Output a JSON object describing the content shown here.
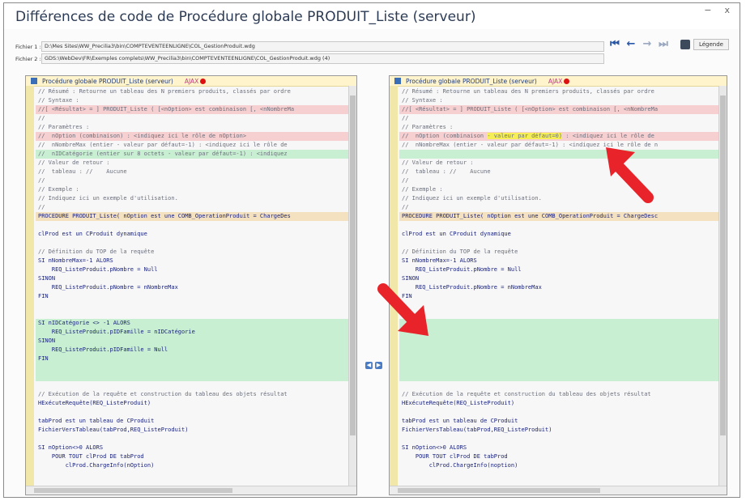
{
  "window": {
    "title": "Différences de code de Procédure globale PRODUIT_Liste (serveur)",
    "min": "−",
    "close": "x"
  },
  "files": {
    "label1": "Fichier 1 :",
    "path1": "D:\\Mes Sites\\WW_Precilia3\\bin\\COMPTEVENTEENLIGNE\\COL_GestionProduit.wdg",
    "label2": "Fichier 2 :",
    "path2": "GDS:\\WebDev\\FR\\Exemples complets\\WW_Precilia3\\bin\\COMPTEVENTEENLIGNE\\COL_GestionProduit.wdg (4)"
  },
  "toolbar": {
    "legend": "Légende"
  },
  "left": {
    "title": "Procédure globale PRODUIT_Liste (serveur)",
    "ajax": "AJAX",
    "lines": [
      {
        "t": "// Résumé : Retourne un tableau des N premiers produits, classés par ordre",
        "c": "cmt"
      },
      {
        "t": "// Syntaxe :",
        "c": "cmt"
      },
      {
        "t": "//[ <Résultat> = ] PRODUIT_Liste ( [<nOption> est combinaison [, <nNombreMa",
        "c": "cmt del"
      },
      {
        "t": "//",
        "c": "cmt"
      },
      {
        "t": "// Paramètres :",
        "c": "cmt"
      },
      {
        "t": "//  nOption (combinaison) : <indiquez ici le rôle de nOption>",
        "c": "cmt del"
      },
      {
        "t": "//  nNombreMax (entier - valeur par défaut=-1) : <indiquez ici le rôle de",
        "c": "cmt"
      },
      {
        "t": "//  nIDCatégorie (entier sur 8 octets - valeur par défaut=-1) : <indiquez",
        "c": "cmt add"
      },
      {
        "t": "// Valeur de retour :",
        "c": "cmt"
      },
      {
        "t": "//  tableau : //    Aucune",
        "c": "cmt"
      },
      {
        "t": "//",
        "c": "cmt"
      },
      {
        "t": "// Exemple :",
        "c": "cmt"
      },
      {
        "t": "// Indiquez ici un exemple d'utilisation.",
        "c": "cmt"
      },
      {
        "t": "//",
        "c": "cmt"
      },
      {
        "t": "PROCEDURE PRODUIT_Liste( nOption est une COMB_OperationProduit = ChargeDes",
        "c": "kw chg"
      },
      {
        "t": "",
        "c": ""
      },
      {
        "t": "clProd est un CProduit dynamique",
        "c": "kw"
      },
      {
        "t": "",
        "c": ""
      },
      {
        "t": "// Définition du TOP de la requête",
        "c": "cmt"
      },
      {
        "t": "SI nNombreMax=-1 ALORS",
        "c": "kw"
      },
      {
        "t": "    REQ_ListeProduit.pNombre = Null",
        "c": "kw"
      },
      {
        "t": "SINON",
        "c": "kw"
      },
      {
        "t": "    REQ_ListeProduit.pNombre = nNombreMax",
        "c": "kw"
      },
      {
        "t": "FIN",
        "c": "kw"
      },
      {
        "t": "",
        "c": ""
      },
      {
        "t": "",
        "c": ""
      },
      {
        "t": "SI nIDCatégorie <> -1 ALORS",
        "c": "kw add"
      },
      {
        "t": "    REQ_ListeProduit.pIDFamille = nIDCatégorie",
        "c": "kw add"
      },
      {
        "t": "SINON",
        "c": "kw add"
      },
      {
        "t": "    REQ_ListeProduit.pIDFamille = Null",
        "c": "kw add"
      },
      {
        "t": "FIN",
        "c": "kw add"
      },
      {
        "t": "",
        "c": "add"
      },
      {
        "t": "",
        "c": "add"
      },
      {
        "t": "",
        "c": ""
      },
      {
        "t": "// Exécution de la requête et construction du tableau des objets résultat",
        "c": "cmt"
      },
      {
        "t": "HExécuteRequête(REQ_ListeProduit)",
        "c": "kw"
      },
      {
        "t": "",
        "c": ""
      },
      {
        "t": "tabProd est un tableau de CProduit",
        "c": "kw"
      },
      {
        "t": "FichierVersTableau(tabProd,REQ_ListeProduit)",
        "c": "kw"
      },
      {
        "t": "",
        "c": ""
      },
      {
        "t": "SI nOption<>0 ALORS",
        "c": "kw"
      },
      {
        "t": "    POUR TOUT clProd DE tabProd",
        "c": "kw"
      },
      {
        "t": "        clProd.ChargeInfo(nOption)",
        "c": "kw"
      }
    ]
  },
  "right": {
    "title": "Procédure globale PRODUIT_Liste (serveur)",
    "ajax": "AJAX",
    "lines": [
      {
        "t": "// Résumé : Retourne un tableau des N premiers produits, classés par ordre",
        "c": "cmt"
      },
      {
        "t": "// Syntaxe :",
        "c": "cmt"
      },
      {
        "t": "//[ <Résultat> = ] PRODUIT_Liste ( [<nOption> est combinaison [, <nNombreMa",
        "c": "cmt del"
      },
      {
        "t": "//",
        "c": "cmt"
      },
      {
        "t": "// Paramètres :",
        "c": "cmt"
      },
      {
        "t": "//  nOption (combinaison - valeur par défaut=0) : <indiquez ici le rôle de",
        "c": "cmt del",
        "hl": "- valeur par défaut=0)"
      },
      {
        "t": "//  nNombreMax (entier - valeur par défaut=-1) : <indiquez ici le rôle de n",
        "c": "cmt"
      },
      {
        "t": "",
        "c": "add"
      },
      {
        "t": "// Valeur de retour :",
        "c": "cmt"
      },
      {
        "t": "//  tableau : //    Aucune",
        "c": "cmt"
      },
      {
        "t": "//",
        "c": "cmt"
      },
      {
        "t": "// Exemple :",
        "c": "cmt"
      },
      {
        "t": "// Indiquez ici un exemple d'utilisation.",
        "c": "cmt"
      },
      {
        "t": "//",
        "c": "cmt"
      },
      {
        "t": "PROCEDURE PRODUIT_Liste( nOption est une COMB_OperationProduit = ChargeDesc",
        "c": "kw chg"
      },
      {
        "t": "",
        "c": ""
      },
      {
        "t": "clProd est un CProduit dynamique",
        "c": "kw"
      },
      {
        "t": "",
        "c": ""
      },
      {
        "t": "// Définition du TOP de la requête",
        "c": "cmt"
      },
      {
        "t": "SI nNombreMax=-1 ALORS",
        "c": "kw"
      },
      {
        "t": "    REQ_ListeProduit.pNombre = Null",
        "c": "kw"
      },
      {
        "t": "SINON",
        "c": "kw"
      },
      {
        "t": "    REQ_ListeProduit.pNombre = nNombreMax",
        "c": "kw"
      },
      {
        "t": "FIN",
        "c": "kw"
      },
      {
        "t": "",
        "c": ""
      },
      {
        "t": "",
        "c": ""
      },
      {
        "t": "",
        "c": "add"
      },
      {
        "t": "",
        "c": "add"
      },
      {
        "t": "",
        "c": "add"
      },
      {
        "t": "",
        "c": "add"
      },
      {
        "t": "",
        "c": "add"
      },
      {
        "t": "",
        "c": "add"
      },
      {
        "t": "",
        "c": "add"
      },
      {
        "t": "",
        "c": ""
      },
      {
        "t": "// Exécution de la requête et construction du tableau des objets résultat",
        "c": "cmt"
      },
      {
        "t": "HExécuteRequête(REQ_ListeProduit)",
        "c": "kw"
      },
      {
        "t": "",
        "c": ""
      },
      {
        "t": "tabProd est un tableau de CProduit",
        "c": "kw"
      },
      {
        "t": "FichierVersTableau(tabProd,REQ_ListeProduit)",
        "c": "kw"
      },
      {
        "t": "",
        "c": ""
      },
      {
        "t": "SI nOption<>0 ALORS",
        "c": "kw"
      },
      {
        "t": "    POUR TOUT clProd DE tabProd",
        "c": "kw"
      },
      {
        "t": "        clProd.ChargeInfo(noption)",
        "c": "kw"
      }
    ]
  },
  "colors": {
    "deleted": "#f6cfd0",
    "added": "#c9efd2",
    "highlight": "#f5ef55",
    "annotation_arrow": "#e8232a"
  }
}
